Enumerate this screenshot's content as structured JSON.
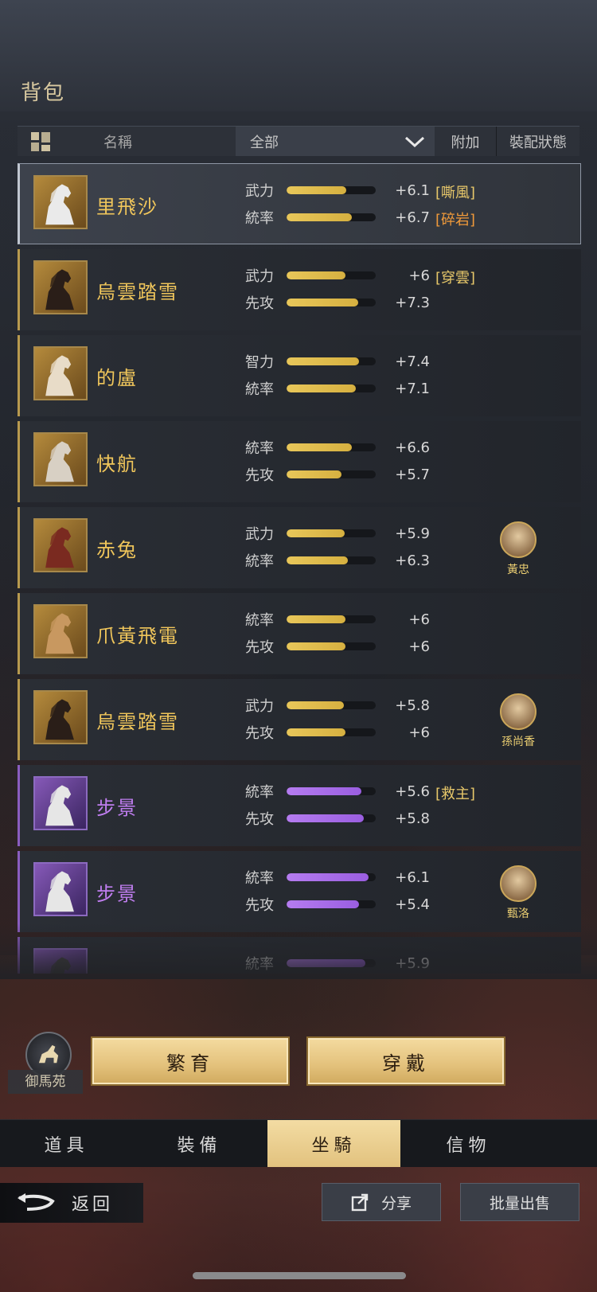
{
  "title": "背包",
  "header": {
    "name_label": "名稱",
    "filter_value": "全部",
    "attach_label": "附加",
    "status_label": "裝配狀態"
  },
  "rows": [
    {
      "name": "里飛沙",
      "quality": "gold",
      "selected": true,
      "stats": [
        {
          "label": "武力",
          "fill": 0.67,
          "value": "+6.1"
        },
        {
          "label": "統率",
          "fill": 0.73,
          "value": "+6.7"
        }
      ],
      "tags": [
        {
          "text": "[嘶風]",
          "color": "#e8c86a"
        },
        {
          "text": "[碎岩]",
          "color": "#f09a3a"
        }
      ],
      "hero": null
    },
    {
      "name": "烏雲踏雪",
      "quality": "gold",
      "selected": false,
      "stats": [
        {
          "label": "武力",
          "fill": 0.66,
          "value": "+6"
        },
        {
          "label": "先攻",
          "fill": 0.8,
          "value": "+7.3"
        }
      ],
      "tags": [
        {
          "text": "[穿雲]",
          "color": "#e8c86a"
        }
      ],
      "hero": null
    },
    {
      "name": "的盧",
      "quality": "gold",
      "selected": false,
      "stats": [
        {
          "label": "智力",
          "fill": 0.81,
          "value": "+7.4"
        },
        {
          "label": "統率",
          "fill": 0.78,
          "value": "+7.1"
        }
      ],
      "tags": [],
      "hero": null
    },
    {
      "name": "快航",
      "quality": "gold",
      "selected": false,
      "stats": [
        {
          "label": "統率",
          "fill": 0.73,
          "value": "+6.6"
        },
        {
          "label": "先攻",
          "fill": 0.62,
          "value": "+5.7"
        }
      ],
      "tags": [],
      "hero": null
    },
    {
      "name": "赤兔",
      "quality": "gold",
      "selected": false,
      "stats": [
        {
          "label": "武力",
          "fill": 0.65,
          "value": "+5.9"
        },
        {
          "label": "統率",
          "fill": 0.69,
          "value": "+6.3"
        }
      ],
      "tags": [],
      "hero": {
        "name": "黃忠"
      }
    },
    {
      "name": "爪黃飛電",
      "quality": "gold",
      "selected": false,
      "stats": [
        {
          "label": "統率",
          "fill": 0.66,
          "value": "+6"
        },
        {
          "label": "先攻",
          "fill": 0.66,
          "value": "+6"
        }
      ],
      "tags": [],
      "hero": null
    },
    {
      "name": "烏雲踏雪",
      "quality": "gold",
      "selected": false,
      "stats": [
        {
          "label": "武力",
          "fill": 0.64,
          "value": "+5.8"
        },
        {
          "label": "先攻",
          "fill": 0.66,
          "value": "+6"
        }
      ],
      "tags": [],
      "hero": {
        "name": "孫尚香"
      }
    },
    {
      "name": "步景",
      "quality": "purple",
      "selected": false,
      "stats": [
        {
          "label": "統率",
          "fill": 0.84,
          "value": "+5.6"
        },
        {
          "label": "先攻",
          "fill": 0.87,
          "value": "+5.8"
        }
      ],
      "tags": [
        {
          "text": "[救主]",
          "color": "#e8c86a"
        }
      ],
      "hero": null
    },
    {
      "name": "步景",
      "quality": "purple",
      "selected": false,
      "stats": [
        {
          "label": "統率",
          "fill": 0.92,
          "value": "+6.1"
        },
        {
          "label": "先攻",
          "fill": 0.81,
          "value": "+5.4"
        }
      ],
      "tags": [],
      "hero": {
        "name": "甄洛"
      }
    },
    {
      "name": "",
      "quality": "purple",
      "selected": false,
      "stats": [
        {
          "label": "統率",
          "fill": 0.88,
          "value": "+5.9"
        },
        {
          "label": "",
          "fill": 0,
          "value": ""
        }
      ],
      "tags": [],
      "hero": null
    }
  ],
  "stable_label": "御馬苑",
  "breed_label": "繁育",
  "wear_label": "穿戴",
  "tabs": [
    {
      "label": "道具",
      "active": false
    },
    {
      "label": "裝備",
      "active": false
    },
    {
      "label": "坐騎",
      "active": true
    },
    {
      "label": "信物",
      "active": false
    }
  ],
  "back_label": "返回",
  "share_label": "分享",
  "sell_label": "批量出售",
  "icons": {
    "grid": "grid-icon",
    "chevron": "chevron-down-icon",
    "back": "back-arrow-icon",
    "share": "share-icon",
    "stable": "horse-icon"
  }
}
